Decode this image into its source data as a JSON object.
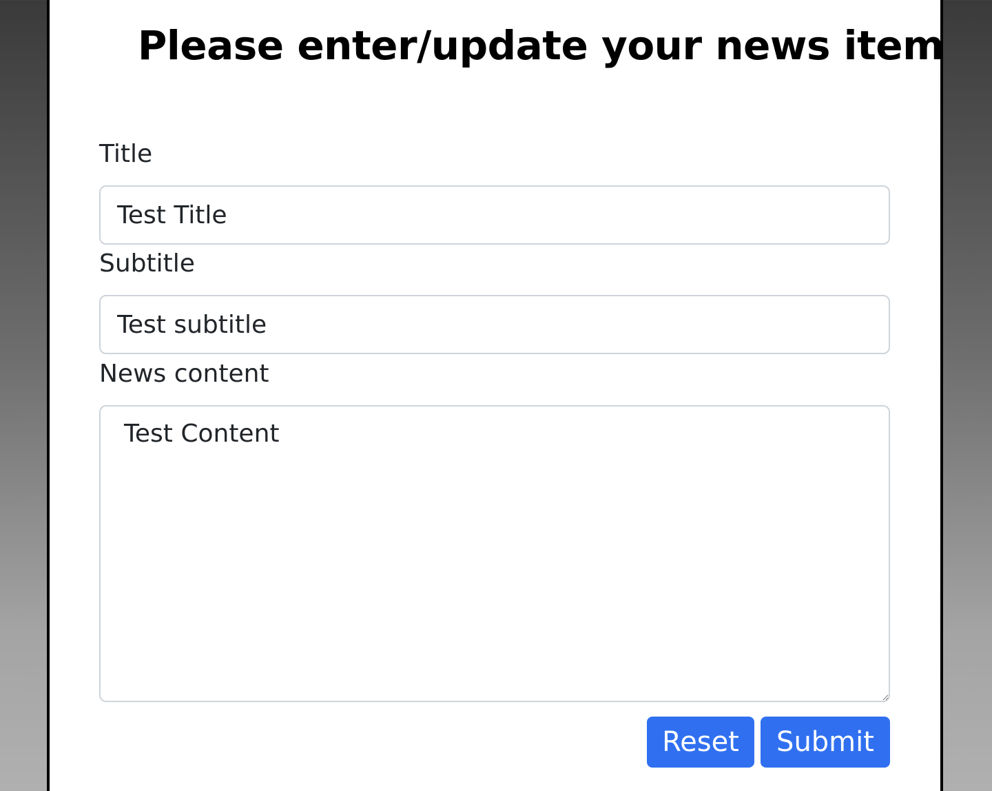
{
  "form": {
    "heading": "Please enter/update your news item",
    "title_label": "Title",
    "title_value": "Test Title",
    "subtitle_label": "Subtitle",
    "subtitle_value": "Test subtitle",
    "content_label": "News content",
    "content_value": "Test Content",
    "reset_label": "Reset",
    "submit_label": "Submit"
  },
  "colors": {
    "button_primary": "#3070f0",
    "input_border": "#ced4da",
    "text": "#212529"
  }
}
